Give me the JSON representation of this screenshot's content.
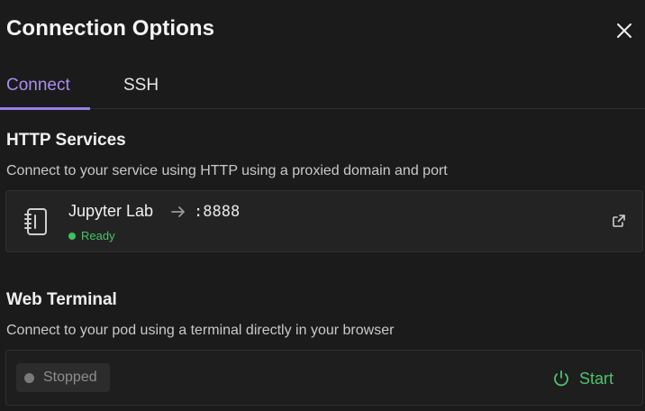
{
  "dialog": {
    "title": "Connection Options",
    "close_icon": "close-icon"
  },
  "tabs": [
    {
      "label": "Connect",
      "active": true
    },
    {
      "label": "SSH",
      "active": false
    }
  ],
  "http_services": {
    "title": "HTTP Services",
    "description": "Connect to your service using HTTP using a proxied domain and port",
    "services": [
      {
        "name": "Jupyter Lab",
        "port": ":8888",
        "status": "Ready",
        "icon": "notebook-icon",
        "link_icon": "external-link-icon"
      }
    ]
  },
  "web_terminal": {
    "title": "Web Terminal",
    "description": "Connect to your pod using a terminal directly in your browser",
    "status": "Stopped",
    "action_label": "Start",
    "action_icon": "power-icon"
  },
  "colors": {
    "accent": "#9b7ee8",
    "ready": "#46c46a",
    "stopped": "#7a7a7a",
    "background": "#1b1b1b"
  }
}
